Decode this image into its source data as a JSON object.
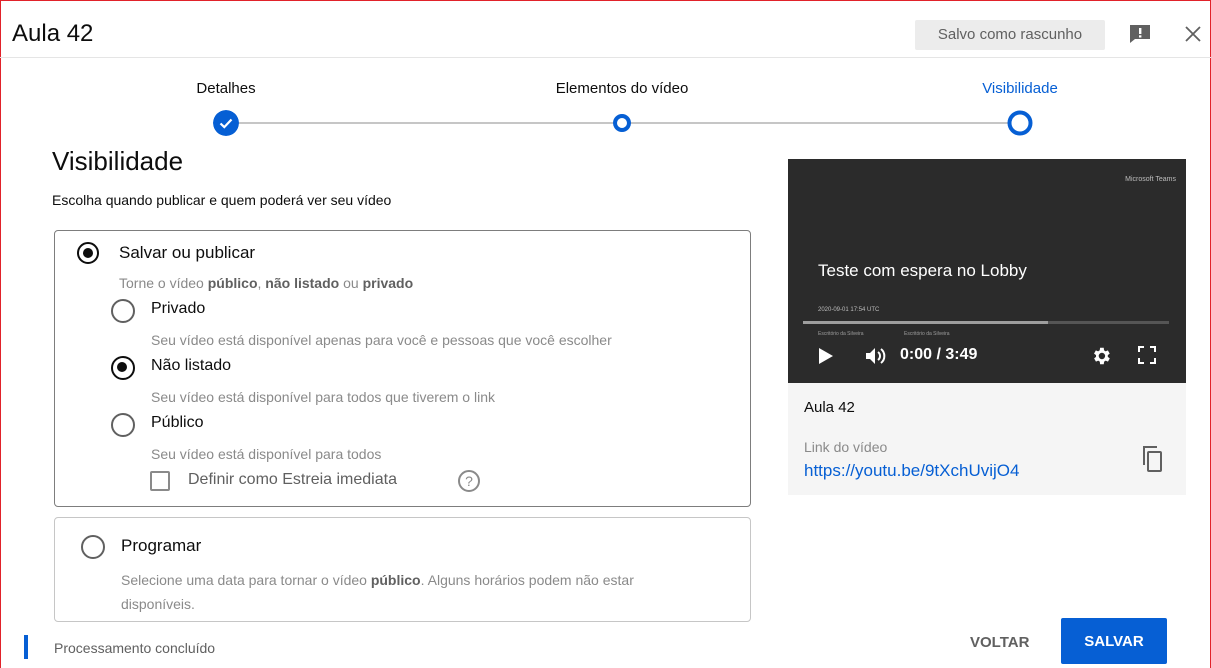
{
  "header": {
    "title": "Aula 42",
    "draft_status": "Salvo como rascunho",
    "feedback_icon": "feedback-icon",
    "close_icon": "close-icon"
  },
  "stepper": {
    "steps": [
      {
        "label": "Detalhes",
        "state": "complete"
      },
      {
        "label": "Elementos do vídeo",
        "state": "incomplete"
      },
      {
        "label": "Visibilidade",
        "state": "current"
      }
    ]
  },
  "visibility": {
    "heading": "Visibilidade",
    "subtitle": "Escolha quando publicar e quem poderá ver seu vídeo",
    "save_publish": {
      "label": "Salvar ou publicar",
      "selected": true,
      "desc_parts": [
        "Torne o vídeo ",
        "público",
        ", ",
        "não listado",
        " ou ",
        "privado"
      ],
      "options": [
        {
          "label": "Privado",
          "desc": "Seu vídeo está disponível apenas para você e pessoas que você escolher",
          "selected": false
        },
        {
          "label": "Não listado",
          "desc": "Seu vídeo está disponível para todos que tiverem o link",
          "selected": true
        },
        {
          "label": "Público",
          "desc": "Seu vídeo está disponível para todos",
          "selected": false
        }
      ],
      "premiere_label": "Definir como Estreia imediata",
      "premiere_checked": false,
      "help_glyph": "?"
    },
    "schedule": {
      "label": "Programar",
      "selected": false,
      "desc_parts": [
        "Selecione uma data para tornar o vídeo ",
        "público",
        ". Alguns horários podem não estar disponíveis."
      ]
    }
  },
  "preview": {
    "brand": "Microsoft Teams",
    "video_title": "Teste com espera no Lobby",
    "video_date": "2020-09-01 17:54 UTC",
    "presenter_1": "Escritório da Silveira",
    "presenter_2": "Escritório da Silveira",
    "time": "0:00 / 3:49",
    "progress": 0.67,
    "file_title": "Aula 42",
    "link_label": "Link do vídeo",
    "link_url": "https://youtu.be/9tXchUvijO4"
  },
  "footer": {
    "status": "Processamento concluído",
    "back_label": "VOLTAR",
    "save_label": "SALVAR"
  },
  "colors": {
    "accent": "#065fd4",
    "frame": "#e1222a"
  }
}
